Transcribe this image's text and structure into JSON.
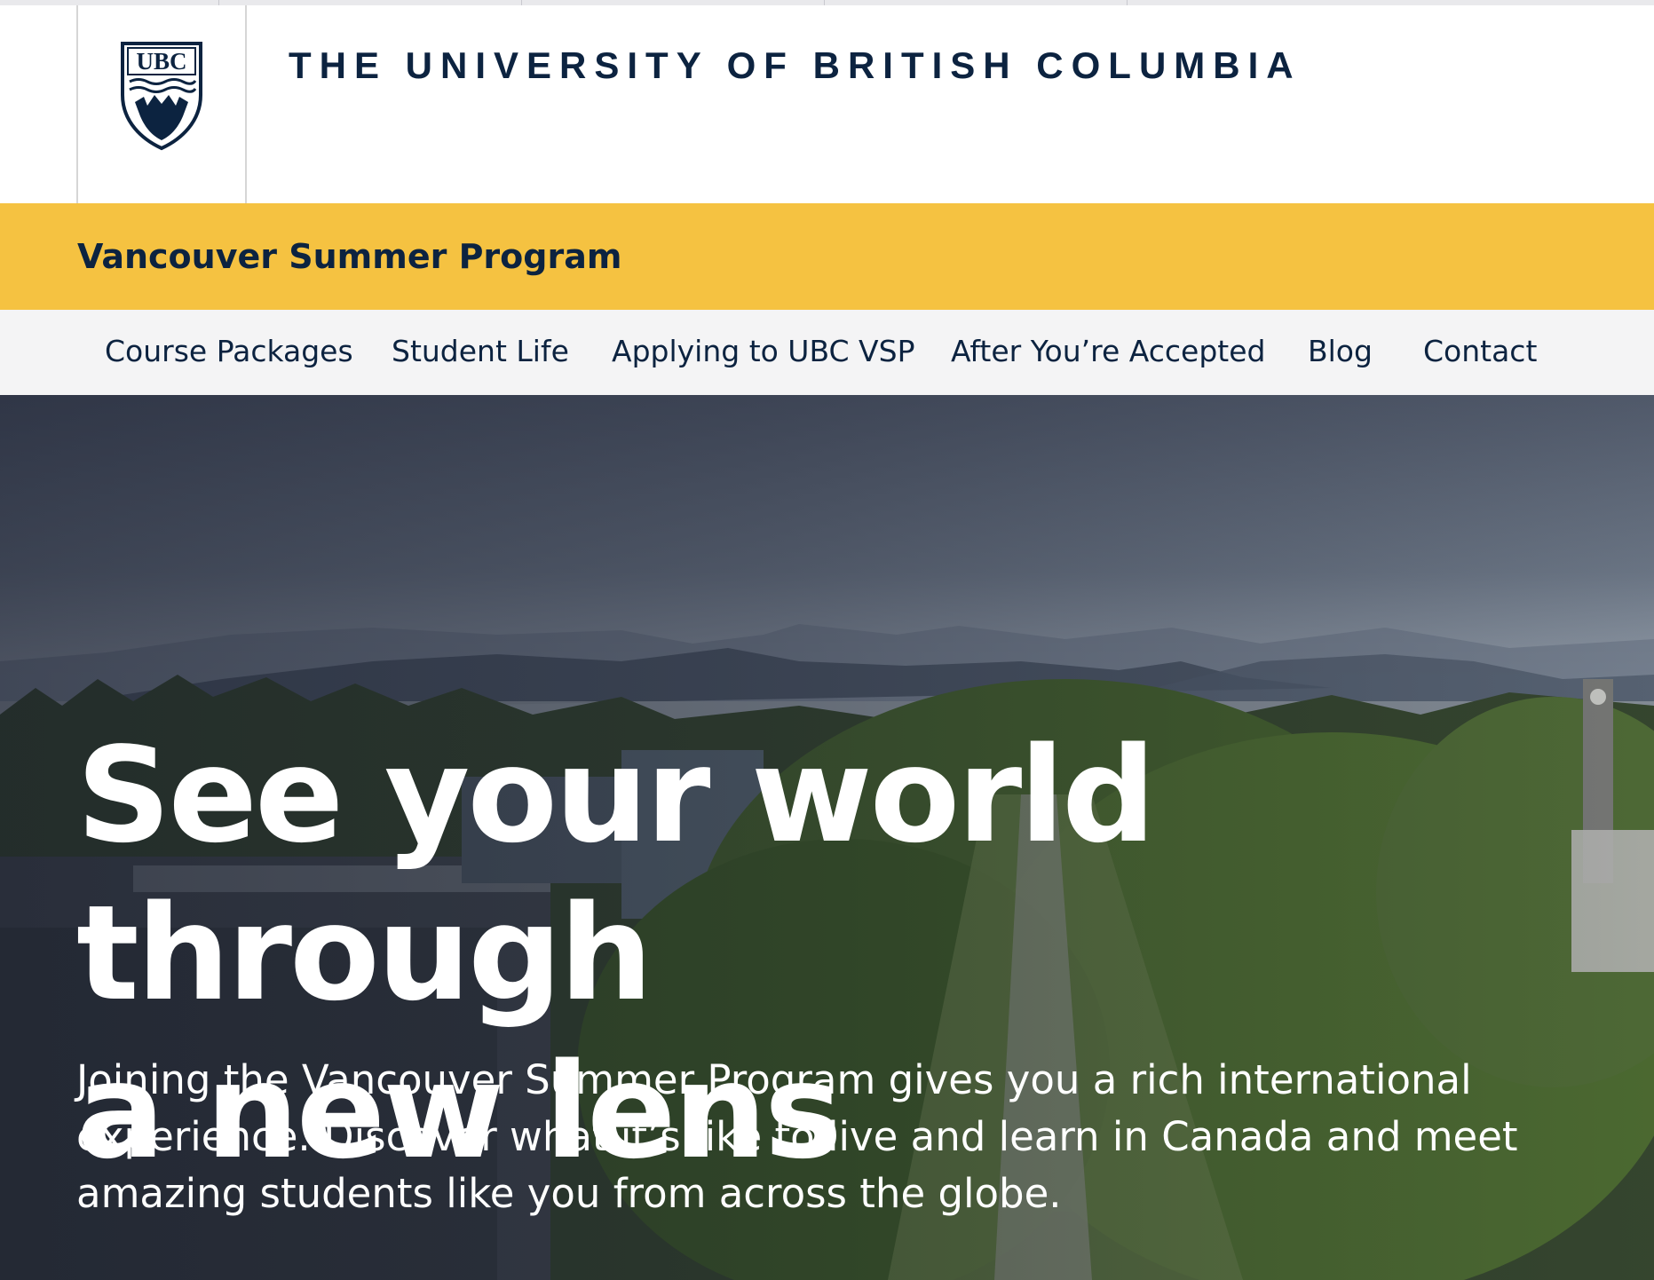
{
  "header": {
    "university_name": "THE UNIVERSITY OF BRITISH COLUMBIA",
    "logo_icon": "ubc-crest-icon",
    "logo_text": "UBC"
  },
  "program_bar": {
    "title": "Vancouver Summer Program"
  },
  "nav": {
    "items": [
      {
        "label": "Course Packages"
      },
      {
        "label": "Student Life"
      },
      {
        "label": "Applying to UBC VSP"
      },
      {
        "label": "After You’re Accepted"
      },
      {
        "label": "Blog"
      },
      {
        "label": "Contact"
      }
    ]
  },
  "hero": {
    "headline_line1": "See your world through",
    "headline_line2": "a new lens",
    "body": "Joining the Vancouver Summer Program gives you a rich international experience. Discover what it’s like to live and learn in Canada and meet amazing students like you from across the globe."
  },
  "colors": {
    "brand_navy": "#0c2340",
    "brand_gold": "#f5c241",
    "nav_bg": "#f4f4f5"
  }
}
